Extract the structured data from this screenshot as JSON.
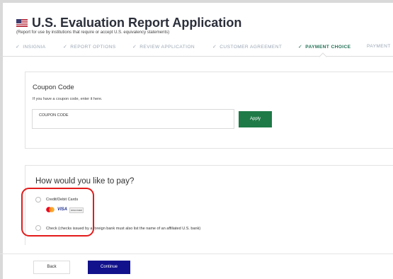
{
  "header": {
    "title": "U.S. Evaluation Report Application",
    "subtitle": "(Report for use by institutions that require or accept U.S. equivalency statements)"
  },
  "steps": [
    {
      "label": "INSIGNIA",
      "completed": true,
      "active": false
    },
    {
      "label": "REPORT OPTIONS",
      "completed": true,
      "active": false
    },
    {
      "label": "REVIEW APPLICATION",
      "completed": true,
      "active": false
    },
    {
      "label": "CUSTOMER AGREEMENT",
      "completed": true,
      "active": false
    },
    {
      "label": "PAYMENT CHOICE",
      "completed": true,
      "active": true
    },
    {
      "label": "PAYMENT",
      "completed": false,
      "active": false
    }
  ],
  "coupon": {
    "title": "Coupon Code",
    "hint": "If you have a coupon code, enter it here.",
    "placeholder": "COUPON CODE",
    "value": "",
    "apply_label": "Apply"
  },
  "payment": {
    "title": "How would you like to pay?",
    "options": [
      {
        "label": "Credit/Debit Cards",
        "selected": false
      },
      {
        "label": "Check (checks issued by a foreign bank must also list the name of an affiliated U.S. bank)",
        "selected": false
      }
    ],
    "card_logos": [
      "mastercard-icon",
      "visa-icon",
      "discover-icon"
    ],
    "visa_text": "VISA",
    "discover_text": "DISCOVER"
  },
  "actions": {
    "back_label": "Back",
    "continue_label": "Continue"
  },
  "colors": {
    "apply": "#1e7a47",
    "continue": "#12128c",
    "active_step": "#1f6f54",
    "highlight": "#e31b1b"
  }
}
